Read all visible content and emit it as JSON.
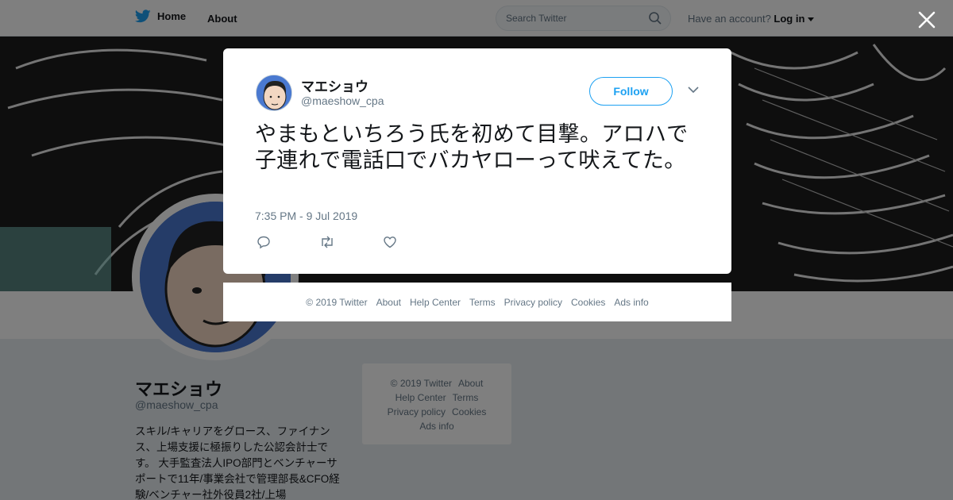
{
  "nav": {
    "home_label": "Home",
    "about_label": "About",
    "search_placeholder": "Search Twitter",
    "account_prompt": "Have an account?",
    "login_label": "Log in"
  },
  "profile": {
    "name": "マエショウ",
    "handle": "@maeshow_cpa",
    "bio": "スキル/キャリアをグロース、ファイナンス、上場支援に極振りした公認会計士です。 大手監査法人IPO部門とベンチャーサポートで11年/事業会社で管理部長&CFO経験/ベンチャー社外役員2社/上場"
  },
  "sidebar_footer": {
    "links": [
      "© 2019 Twitter",
      "About",
      "Help Center",
      "Terms",
      "Privacy policy",
      "Cookies",
      "Ads info"
    ]
  },
  "tweet": {
    "author_name": "マエショウ",
    "author_handle": "@maeshow_cpa",
    "follow_label": "Follow",
    "text": "やまもといちろう氏を初めて目撃。アロハで子連れで電話口でバカヤローって吠えてた。",
    "timestamp": "7:35 PM - 9 Jul 2019"
  },
  "modal_footer": {
    "links": [
      "© 2019 Twitter",
      "About",
      "Help Center",
      "Terms",
      "Privacy policy",
      "Cookies",
      "Ads info"
    ]
  },
  "colors": {
    "accent": "#1da1f2",
    "avatar_bg": "#4a79d0",
    "secondary_text": "#657786"
  }
}
